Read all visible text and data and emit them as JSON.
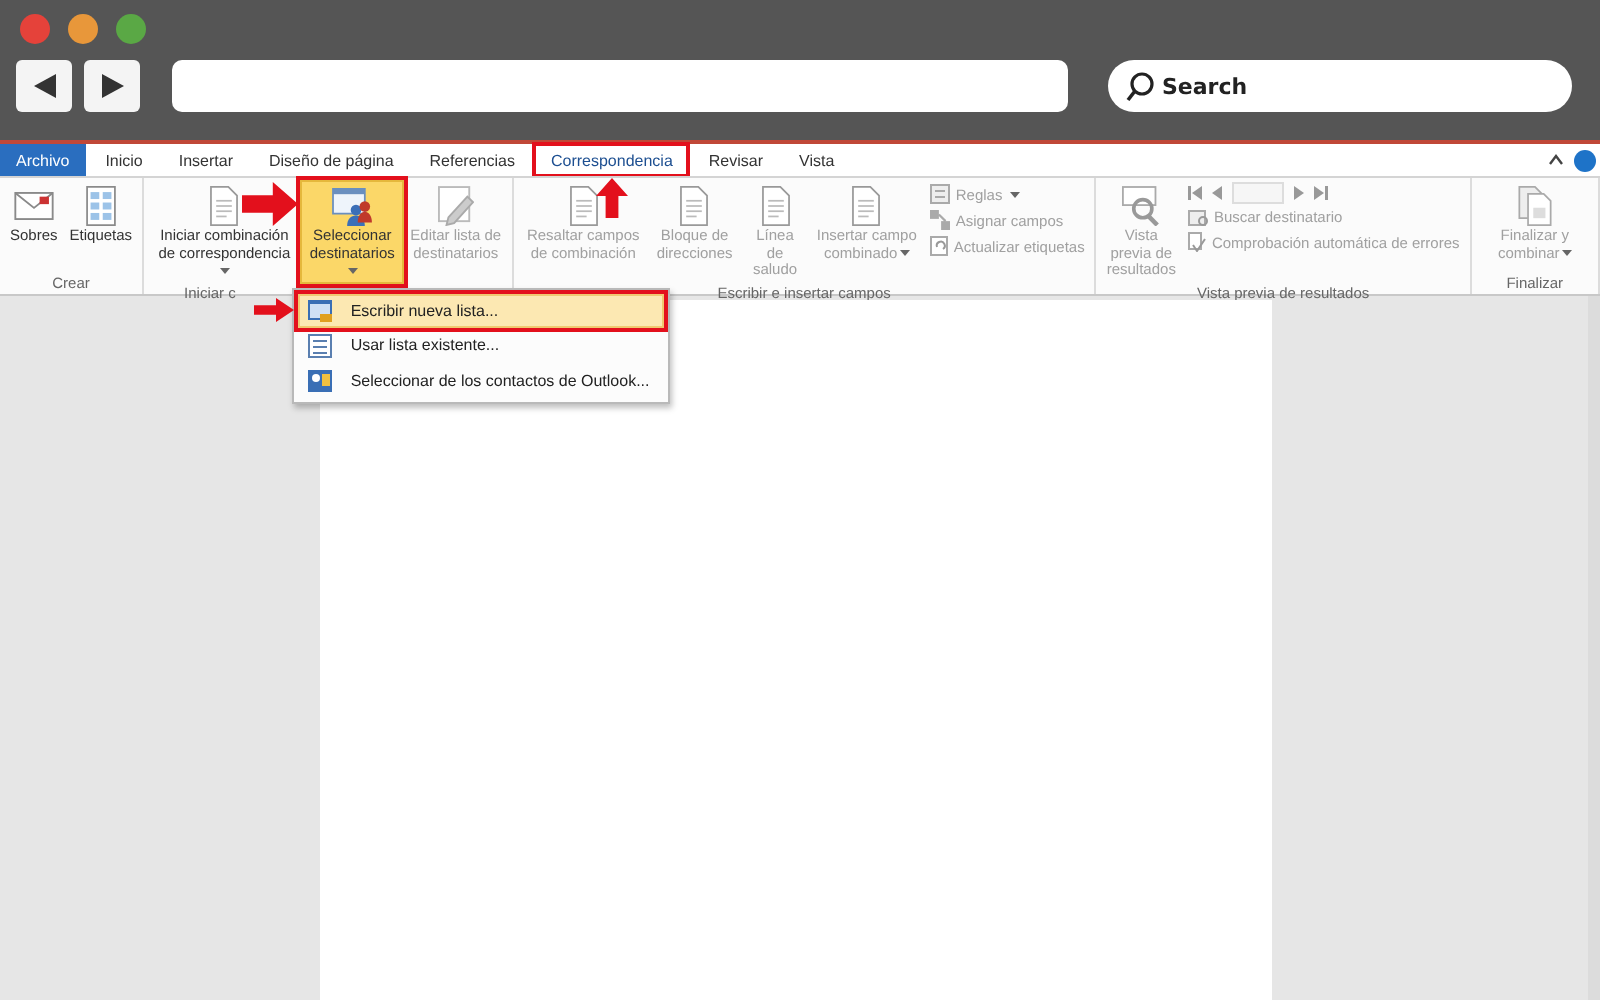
{
  "browser": {
    "search": {
      "placeholder": "Search"
    }
  },
  "tabs": [
    {
      "label": "Archivo",
      "kind": "file",
      "selected": false,
      "annotated": false
    },
    {
      "label": "Inicio",
      "kind": "tab",
      "selected": false,
      "annotated": false
    },
    {
      "label": "Insertar",
      "kind": "tab",
      "selected": false,
      "annotated": false
    },
    {
      "label": "Diseño de página",
      "kind": "tab",
      "selected": false,
      "annotated": false
    },
    {
      "label": "Referencias",
      "kind": "tab",
      "selected": false,
      "annotated": false
    },
    {
      "label": "Correspondencia",
      "kind": "tab",
      "selected": true,
      "annotated": true
    },
    {
      "label": "Revisar",
      "kind": "tab",
      "selected": false,
      "annotated": false
    },
    {
      "label": "Vista",
      "kind": "tab",
      "selected": false,
      "annotated": false
    }
  ],
  "groups": [
    {
      "label": "Crear",
      "items": [
        {
          "kind": "large",
          "label": "Sobres",
          "dropdown": false,
          "disabled": false,
          "highlighted": false,
          "annotated": false
        },
        {
          "kind": "large",
          "label": "Etiquetas",
          "dropdown": false,
          "disabled": false,
          "highlighted": false,
          "annotated": false
        }
      ]
    },
    {
      "label": "Iniciar c",
      "items": [
        {
          "kind": "large",
          "label": "Iniciar combinación de correspondencia",
          "dropdown": true,
          "disabled": false,
          "highlighted": false,
          "annotated": false
        },
        {
          "kind": "large",
          "label": "Seleccionar destinatarios",
          "dropdown": true,
          "disabled": false,
          "highlighted": true,
          "annotated": true
        },
        {
          "kind": "large",
          "label": "Editar lista de destinatarios",
          "dropdown": false,
          "disabled": true,
          "highlighted": false,
          "annotated": false
        }
      ]
    },
    {
      "label": "Escribir e insertar campos",
      "items": [
        {
          "kind": "large",
          "label": "Resaltar campos de combinación",
          "dropdown": false,
          "disabled": true,
          "highlighted": false,
          "annotated": false
        },
        {
          "kind": "large",
          "label": "Bloque de direcciones",
          "dropdown": false,
          "disabled": true,
          "highlighted": false,
          "annotated": false
        },
        {
          "kind": "large",
          "label": "Línea de saludo",
          "dropdown": false,
          "disabled": true,
          "highlighted": false,
          "annotated": false
        },
        {
          "kind": "large",
          "label": "Insertar campo combinado",
          "dropdown": true,
          "disabled": true,
          "highlighted": false,
          "annotated": false
        },
        {
          "kind": "stack",
          "rows": [
            {
              "label": "Reglas",
              "dropdown": true,
              "disabled": true
            },
            {
              "label": "Asignar campos",
              "dropdown": false,
              "disabled": true
            },
            {
              "label": "Actualizar etiquetas",
              "dropdown": false,
              "disabled": true
            }
          ]
        }
      ]
    },
    {
      "label": "Vista previa de resultados",
      "items": [
        {
          "kind": "large",
          "label": "Vista previa de resultados",
          "dropdown": false,
          "disabled": true,
          "highlighted": false,
          "annotated": false
        },
        {
          "kind": "navstack",
          "disabled": true,
          "rows": [
            {
              "label": "Buscar destinatario",
              "dropdown": false,
              "disabled": true
            },
            {
              "label": "Comprobación automática de errores",
              "dropdown": false,
              "disabled": true
            }
          ]
        }
      ]
    },
    {
      "label": "Finalizar",
      "items": [
        {
          "kind": "large",
          "label": "Finalizar y combinar",
          "dropdown": true,
          "disabled": true,
          "highlighted": false,
          "annotated": false
        }
      ]
    }
  ],
  "menu": {
    "items": [
      {
        "label": "Escribir nueva lista...",
        "selected": true,
        "annotated": true
      },
      {
        "label": "Usar lista existente...",
        "selected": false,
        "annotated": false
      },
      {
        "label": "Seleccionar de los contactos de Outlook...",
        "selected": false,
        "annotated": false
      }
    ]
  }
}
